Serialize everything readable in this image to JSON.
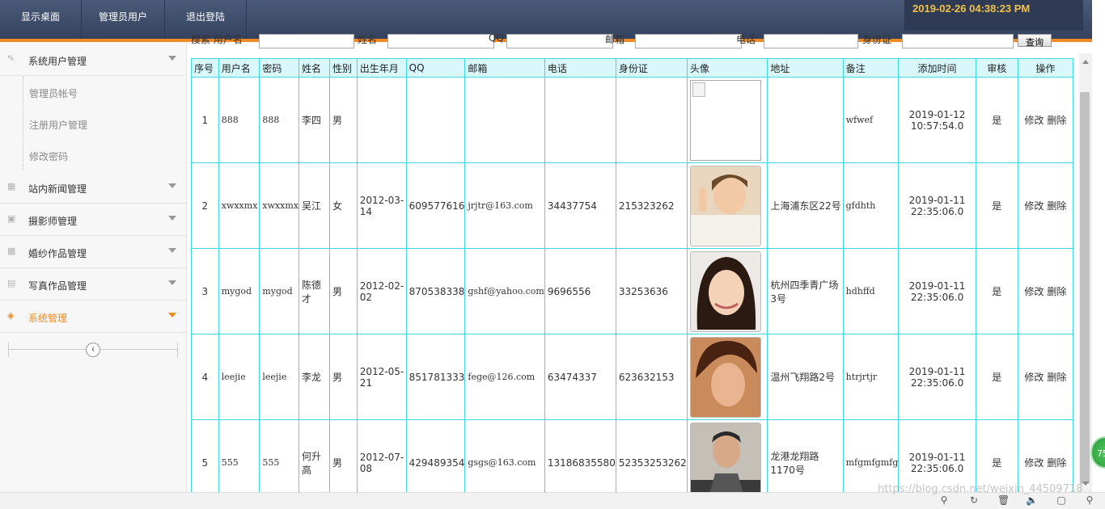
{
  "topnav": {
    "items": [
      "显示桌面",
      "管理员用户",
      "退出登陆"
    ],
    "clock": "2019-02-26 04:38:23 PM"
  },
  "sidebar": {
    "menus": [
      {
        "label": "系统用户管理",
        "icon": "pencil-icon"
      },
      {
        "label": "站内新闻管理",
        "icon": "grid-icon"
      },
      {
        "label": "摄影师管理",
        "icon": "image-icon"
      },
      {
        "label": "婚纱作品管理",
        "icon": "grid-icon"
      },
      {
        "label": "写真作品管理",
        "icon": "calendar-icon"
      },
      {
        "label": "系统管理",
        "icon": "dropbox-icon",
        "active": true
      }
    ],
    "submenu": [
      "管理员帐号",
      "注册用户管理",
      "修改密码"
    ],
    "collapse_icon": "‹"
  },
  "search": {
    "labels": [
      "搜索 用户名",
      "姓名",
      "QQ",
      "邮箱",
      "电话",
      "身份证"
    ],
    "button": "查询"
  },
  "table": {
    "headers": [
      "序号",
      "用户名",
      "密码",
      "姓名",
      "性别",
      "出生年月",
      "QQ",
      "邮箱",
      "电话",
      "身份证",
      "头像",
      "地址",
      "备注",
      "添加时间",
      "审核",
      "操作"
    ],
    "rows": [
      {
        "no": "1",
        "username": "888",
        "password": "888",
        "name": "李四",
        "gender": "男",
        "birth": "",
        "qq": "",
        "email": "",
        "phone": "",
        "idcard": "",
        "avatar": "broken",
        "address": "",
        "remark": "wfwef",
        "time": "2019-01-12 10:57:54.0",
        "approved": "是"
      },
      {
        "no": "2",
        "username": "xwxxmx",
        "password": "xwxxmx",
        "name": "吴江",
        "gender": "女",
        "birth": "2012-03-14",
        "qq": "609577616",
        "email": "jrjtr@163.com",
        "phone": "34437754",
        "idcard": "215323262",
        "avatar": "photo-peace",
        "address": "上海浦东区22号",
        "remark": "gfdhth",
        "time": "2019-01-11 22:35:06.0",
        "approved": "是"
      },
      {
        "no": "3",
        "username": "mygod",
        "password": "mygod",
        "name": "陈德才",
        "gender": "男",
        "birth": "2012-02-02",
        "qq": "870538338",
        "email": "gshf@yahoo.com",
        "phone": "9696556",
        "idcard": "33253636",
        "avatar": "photo-woman",
        "address": "杭州四季青广场3号",
        "remark": "hdhffd",
        "time": "2019-01-11 22:35:06.0",
        "approved": "是"
      },
      {
        "no": "4",
        "username": "leejie",
        "password": "leejie",
        "name": "李龙",
        "gender": "男",
        "birth": "2012-05-21",
        "qq": "851781333",
        "email": "fege@126.com",
        "phone": "63474337",
        "idcard": "623632153",
        "avatar": "photo-man",
        "address": "温州飞翔路2号",
        "remark": "htrjrtjr",
        "time": "2019-01-11 22:35:06.0",
        "approved": "是"
      },
      {
        "no": "5",
        "username": "555",
        "password": "555",
        "name": "何升高",
        "gender": "男",
        "birth": "2012-07-08",
        "qq": "429489354",
        "email": "gsgs@163.com",
        "phone": "13186835580",
        "idcard": "52353253262",
        "avatar": "photo-glasses",
        "address": "龙港龙翔路1170号",
        "remark": "mfgmfgmfg",
        "time": "2019-01-11 22:35:06.0",
        "approved": "是"
      }
    ],
    "op_edit": "修改",
    "op_delete": "删除"
  },
  "badge": "75",
  "watermark": "https://blog.csdn.net/weixin_44509718",
  "colors": {
    "accent": "#f08a24",
    "topbar": "#3c4a68",
    "table_border": "#40d8e0",
    "header_bg": "#d8f8fb",
    "clock": "#f2c24a"
  }
}
